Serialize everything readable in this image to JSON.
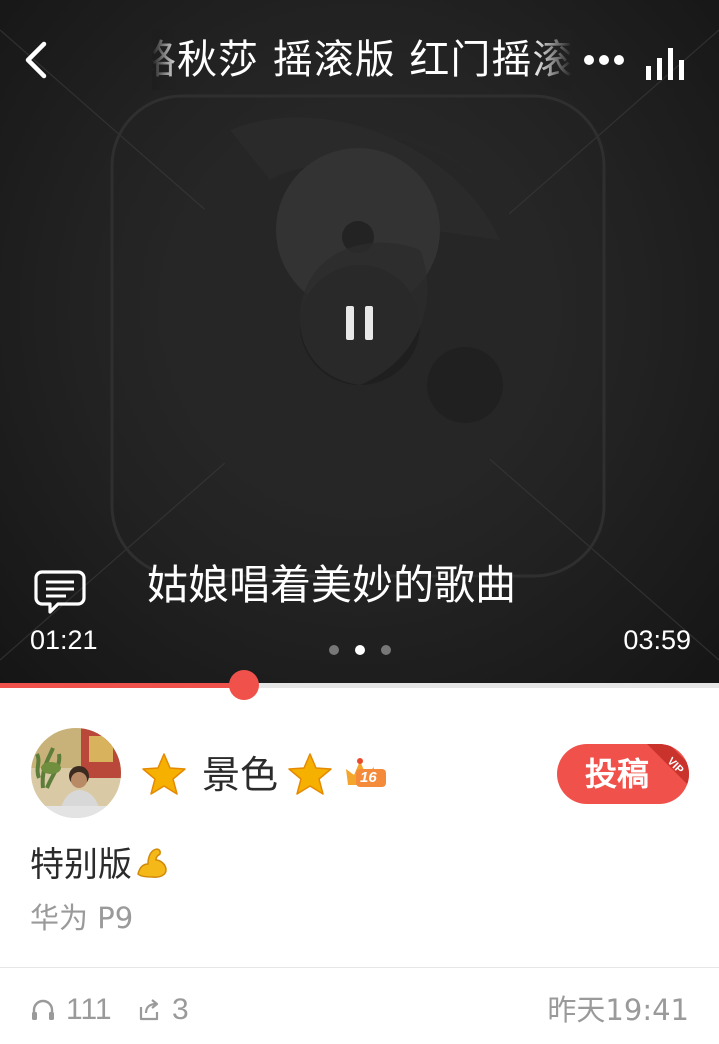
{
  "header": {
    "title": "路秋莎 摇滚版 红门摇滚 ",
    "back_icon": "chevron-left-icon",
    "more_icon": "more-dots-icon",
    "eq_icon": "equalizer-icon"
  },
  "player": {
    "lyric": "姑娘唱着美妙的歌曲",
    "current_time": "01:21",
    "total_time": "03:59",
    "progress": 0.339,
    "page_dots": 3,
    "active_dot": 1,
    "state_icon": "pause-icon",
    "comment_icon": "lyrics-comment-icon"
  },
  "author": {
    "name": "景色",
    "level": "16",
    "avatar_icon": "avatar-photo"
  },
  "submit_button": {
    "label": "投稿",
    "ribbon": "VIP"
  },
  "post": {
    "text": "特别版",
    "emoji": "flexed-biceps-icon",
    "device": "华为 P9",
    "listens": "111",
    "shares": "3",
    "time": "昨天19:41"
  },
  "colors": {
    "accent": "#f0524b",
    "player_bg": "#222222",
    "star": "#f6b000"
  }
}
